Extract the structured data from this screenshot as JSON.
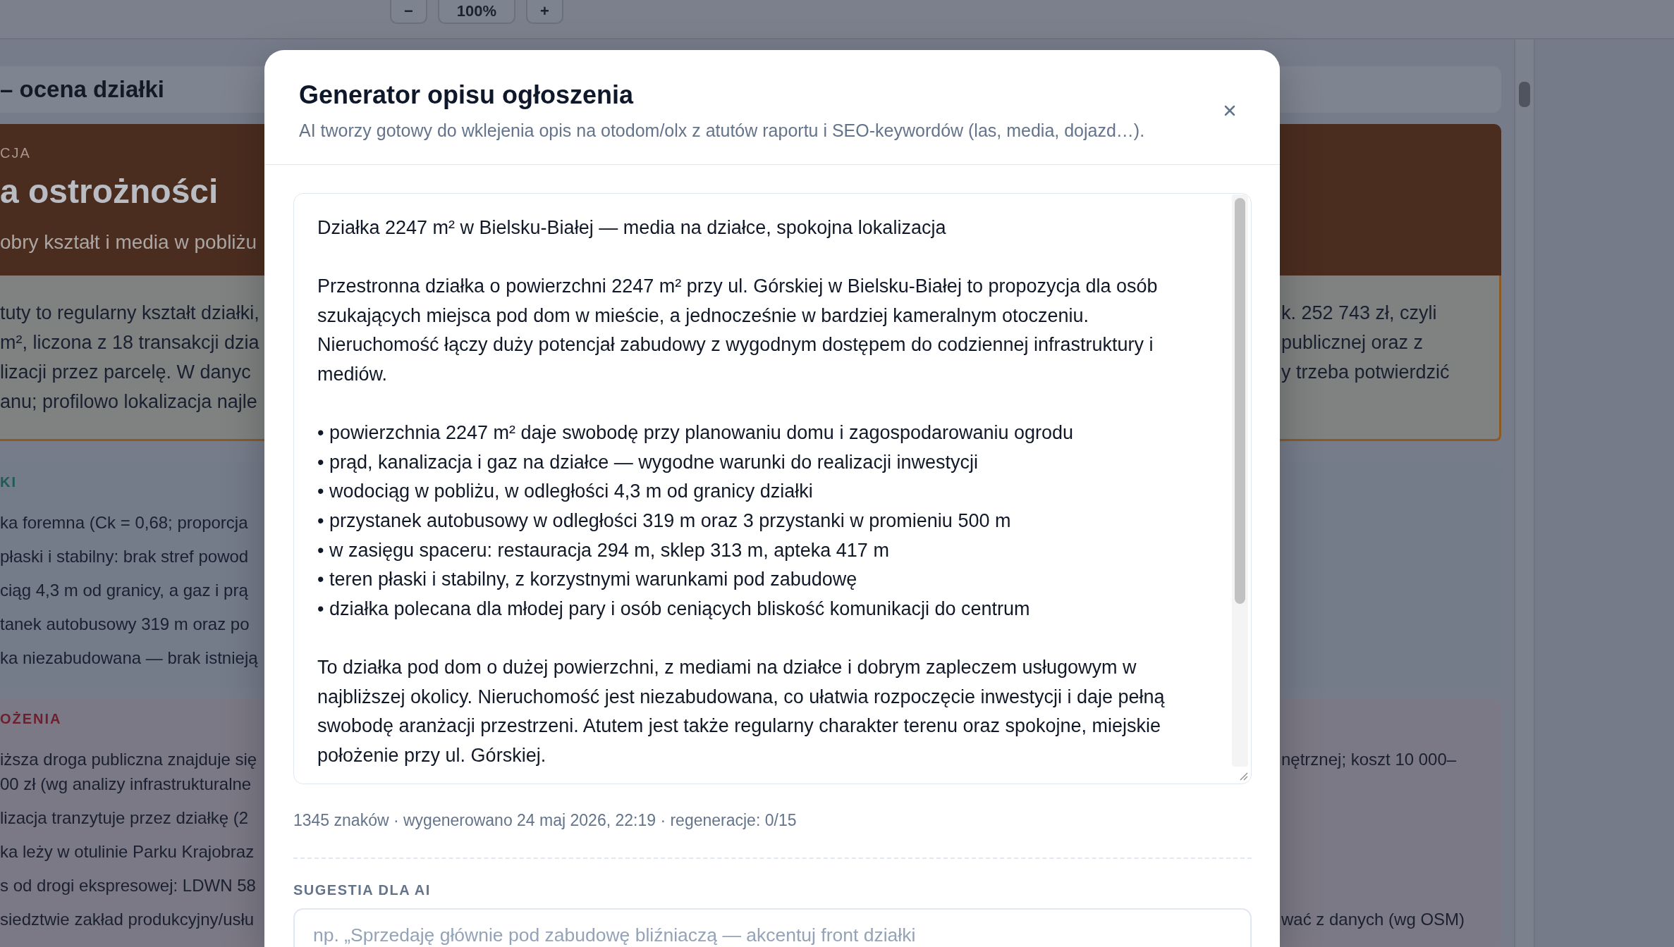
{
  "toolbar": {
    "zoom_out": "−",
    "zoom_level": "100%",
    "zoom_in": "+"
  },
  "report": {
    "section_title": "– ocena działki",
    "verdict": {
      "eyebrow": "CJA",
      "title": "a ostrożności",
      "subtitle": "obry kształt i media w pobliżu",
      "summary_lines": [
        {
          "left": "tuty to regularny kształt działki,",
          "right": "k. 252 743 zł, czyli"
        },
        {
          "left": "m², liczona z 18 transakcji dzia",
          "right": "publicznej oraz z"
        },
        {
          "left": "lizacji przez parcelę. W danyc",
          "right": "y trzeba potwierdzić"
        },
        {
          "left": "anu; profilowo lokalizacja najle"
        }
      ]
    },
    "panels": [
      {
        "kind": "strengths",
        "heading": "KI",
        "items": [
          {
            "lines": [
              {
                "left": "ka foremna (Ck = 0,68; proporcja"
              }
            ]
          },
          {
            "lines": [
              {
                "left": "płaski i stabilny: brak stref powod"
              }
            ]
          },
          {
            "lines": [
              {
                "left": "ciąg 4,3 m od granicy, a gaz i prą"
              }
            ]
          },
          {
            "lines": [
              {
                "left": "tanek autobusowy 319 m oraz po"
              }
            ]
          },
          {
            "lines": [
              {
                "left": "ka niezabudowana — brak istnieją"
              }
            ]
          }
        ]
      },
      {
        "kind": "risks",
        "heading": "OŻENIA",
        "items": [
          {
            "lines": [
              {
                "left": "iższa droga publiczna znajduje się",
                "right": "nętrznej; koszt 10 000–"
              },
              {
                "left": "00 zł (wg analizy infrastrukturalne"
              }
            ]
          },
          {
            "lines": [
              {
                "left": "lizacja tranzytuje przez działkę (2"
              }
            ]
          },
          {
            "lines": [
              {
                "left": "ka leży w otulinie Parku Krajobraz"
              }
            ]
          },
          {
            "lines": [
              {
                "left": "s od drogi ekspresowej: LDWN 58"
              }
            ]
          },
          {
            "lines": [
              {
                "left": "siedztwie zakład produkcyjny/usłu",
                "right": "wać z danych (wg OSM)"
              }
            ]
          }
        ]
      }
    ]
  },
  "modal": {
    "title": "Generator opisu ogłoszenia",
    "subtitle": "AI tworzy gotowy do wklejenia opis na otodom/olx z atutów raportu i SEO-keywordów (las, media, dojazd…).",
    "description": {
      "value": "Działka 2247 m² w Bielsku-Białej — media na działce, spokojna lokalizacja\n\nPrzestronna działka o powierzchni 2247 m² przy ul. Górskiej w Bielsku-Białej to propozycja dla osób\nszukających miejsca pod dom w mieście, a jednocześnie w bardziej kameralnym otoczeniu.\nNieruchomość łączy duży potencjał zabudowy z wygodnym dostępem do codziennej infrastruktury i\nmediów.\n\n• powierzchnia 2247 m² daje swobodę przy planowaniu domu i zagospodarowaniu ogrodu\n• prąd, kanalizacja i gaz na działce — wygodne warunki do realizacji inwestycji\n• wodociąg w pobliżu, w odległości 4,3 m od granicy działki\n• przystanek autobusowy w odległości 319 m oraz 3 przystanki w promieniu 500 m\n• w zasięgu spaceru: restauracja 294 m, sklep 313 m, apteka 417 m\n• teren płaski i stabilny, z korzystnymi warunkami pod zabudowę\n• działka polecana dla młodej pary i osób ceniących bliskość komunikacji do centrum\n\nTo działka pod dom o dużej powierzchni, z mediami na działce i dobrym zapleczem usługowym w\nnajbliższej okolicy. Nieruchomość jest niezabudowana, co ułatwia rozpoczęcie inwestycji i daje pełną\nswobodę aranżacji przestrzeni. Atutem jest także regularny charakter terenu oraz spokojne, miejskie\npołożenie przy ul. Górskiej."
    },
    "meta": "1345 znaków · wygenerowano 24 maj 2026, 22:19 · regeneracje: 0/15",
    "suggestion": {
      "label": "SUGESTIA DLA AI",
      "placeholder": "np. „Sprzedaję głównie pod zabudowę bliźniaczą — akcentuj front działki"
    }
  }
}
